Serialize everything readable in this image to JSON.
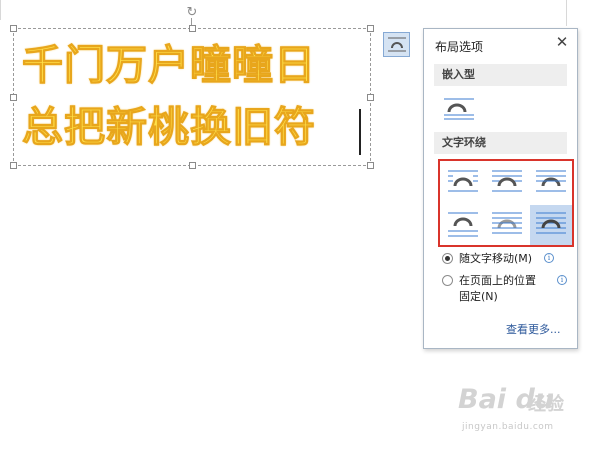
{
  "document": {
    "poem_line_1": "千门万户曈曈日",
    "poem_line_2": "总把新桃换旧符",
    "text_color": "#ffe14a",
    "text_outline_color": "#e8a61c"
  },
  "layout_options_button": {
    "icon": "wrap-square-icon"
  },
  "layout_panel": {
    "title": "布局选项",
    "close_glyph": "✕",
    "inline_section": {
      "heading": "嵌入型",
      "icon": "inline-with-text-icon"
    },
    "wrap_section": {
      "heading": "文字环绕",
      "options": [
        {
          "icon": "wrap-square-icon",
          "selected": false
        },
        {
          "icon": "wrap-tight-icon",
          "selected": false
        },
        {
          "icon": "wrap-through-icon",
          "selected": false
        },
        {
          "icon": "wrap-top-bottom-icon",
          "selected": false
        },
        {
          "icon": "wrap-behind-text-icon",
          "selected": false
        },
        {
          "icon": "wrap-in-front-of-text-icon",
          "selected": true
        }
      ],
      "highlight_color": "#d9342b",
      "selected_color": "#c5d8f0"
    },
    "position_options": [
      {
        "label": "随文字移动(M)",
        "checked": true
      },
      {
        "label": "在页面上的位置",
        "label_line2": "固定(N)",
        "checked": false
      }
    ],
    "info_glyph": "i",
    "see_more": "查看更多..."
  },
  "watermark": {
    "main": "Bai du",
    "cn": "经验",
    "url": "jingyan.baidu.com"
  },
  "accent_color": "#2b579a"
}
